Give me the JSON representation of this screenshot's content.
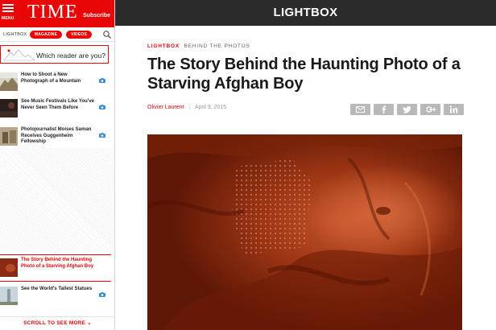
{
  "sidebar": {
    "menu_label": "MENU",
    "brand": "TIME",
    "subscribe": "Subscribe",
    "nav": {
      "lightbox": "LIGHTBOX",
      "magazine": "MAGAZINE",
      "videos": "VIDEOS"
    },
    "reader_prompt": "Which reader are you?",
    "items": [
      {
        "title": "How to Shoot a New Photograph of a Mountain",
        "icon": "camera-icon"
      },
      {
        "title": "See Music Festivals Like You've Never Seen Them Before",
        "icon": "camera-icon"
      },
      {
        "title": "Photojournalist Moises Saman Receives Guggenheim Fellowship",
        "icon": "camera-icon"
      },
      {
        "title": "The Story Behind the Haunting Photo of a Starving Afghan Boy",
        "icon": "none",
        "active": true
      },
      {
        "title": "See the World's Tallest Statues",
        "icon": "camera-icon"
      }
    ],
    "scroll_more": "SCROLL TO SEE MORE"
  },
  "topbar": {
    "title": "LIGHTBOX"
  },
  "article": {
    "kicker_section": "LIGHTBOX",
    "kicker_sub": "BEHIND THE PHOTOS",
    "headline": "The Story Behind the Haunting Photo of a Starving Afghan Boy",
    "author": "Olivier Laurent",
    "date": "April 9, 2015",
    "share_buttons": [
      "email-icon",
      "facebook-icon",
      "twitter-icon",
      "google-plus-icon",
      "linkedin-icon"
    ]
  },
  "colors": {
    "brand_red": "#e90606",
    "topbar": "#2b2b2b",
    "share_gray": "#b9b9b9"
  }
}
